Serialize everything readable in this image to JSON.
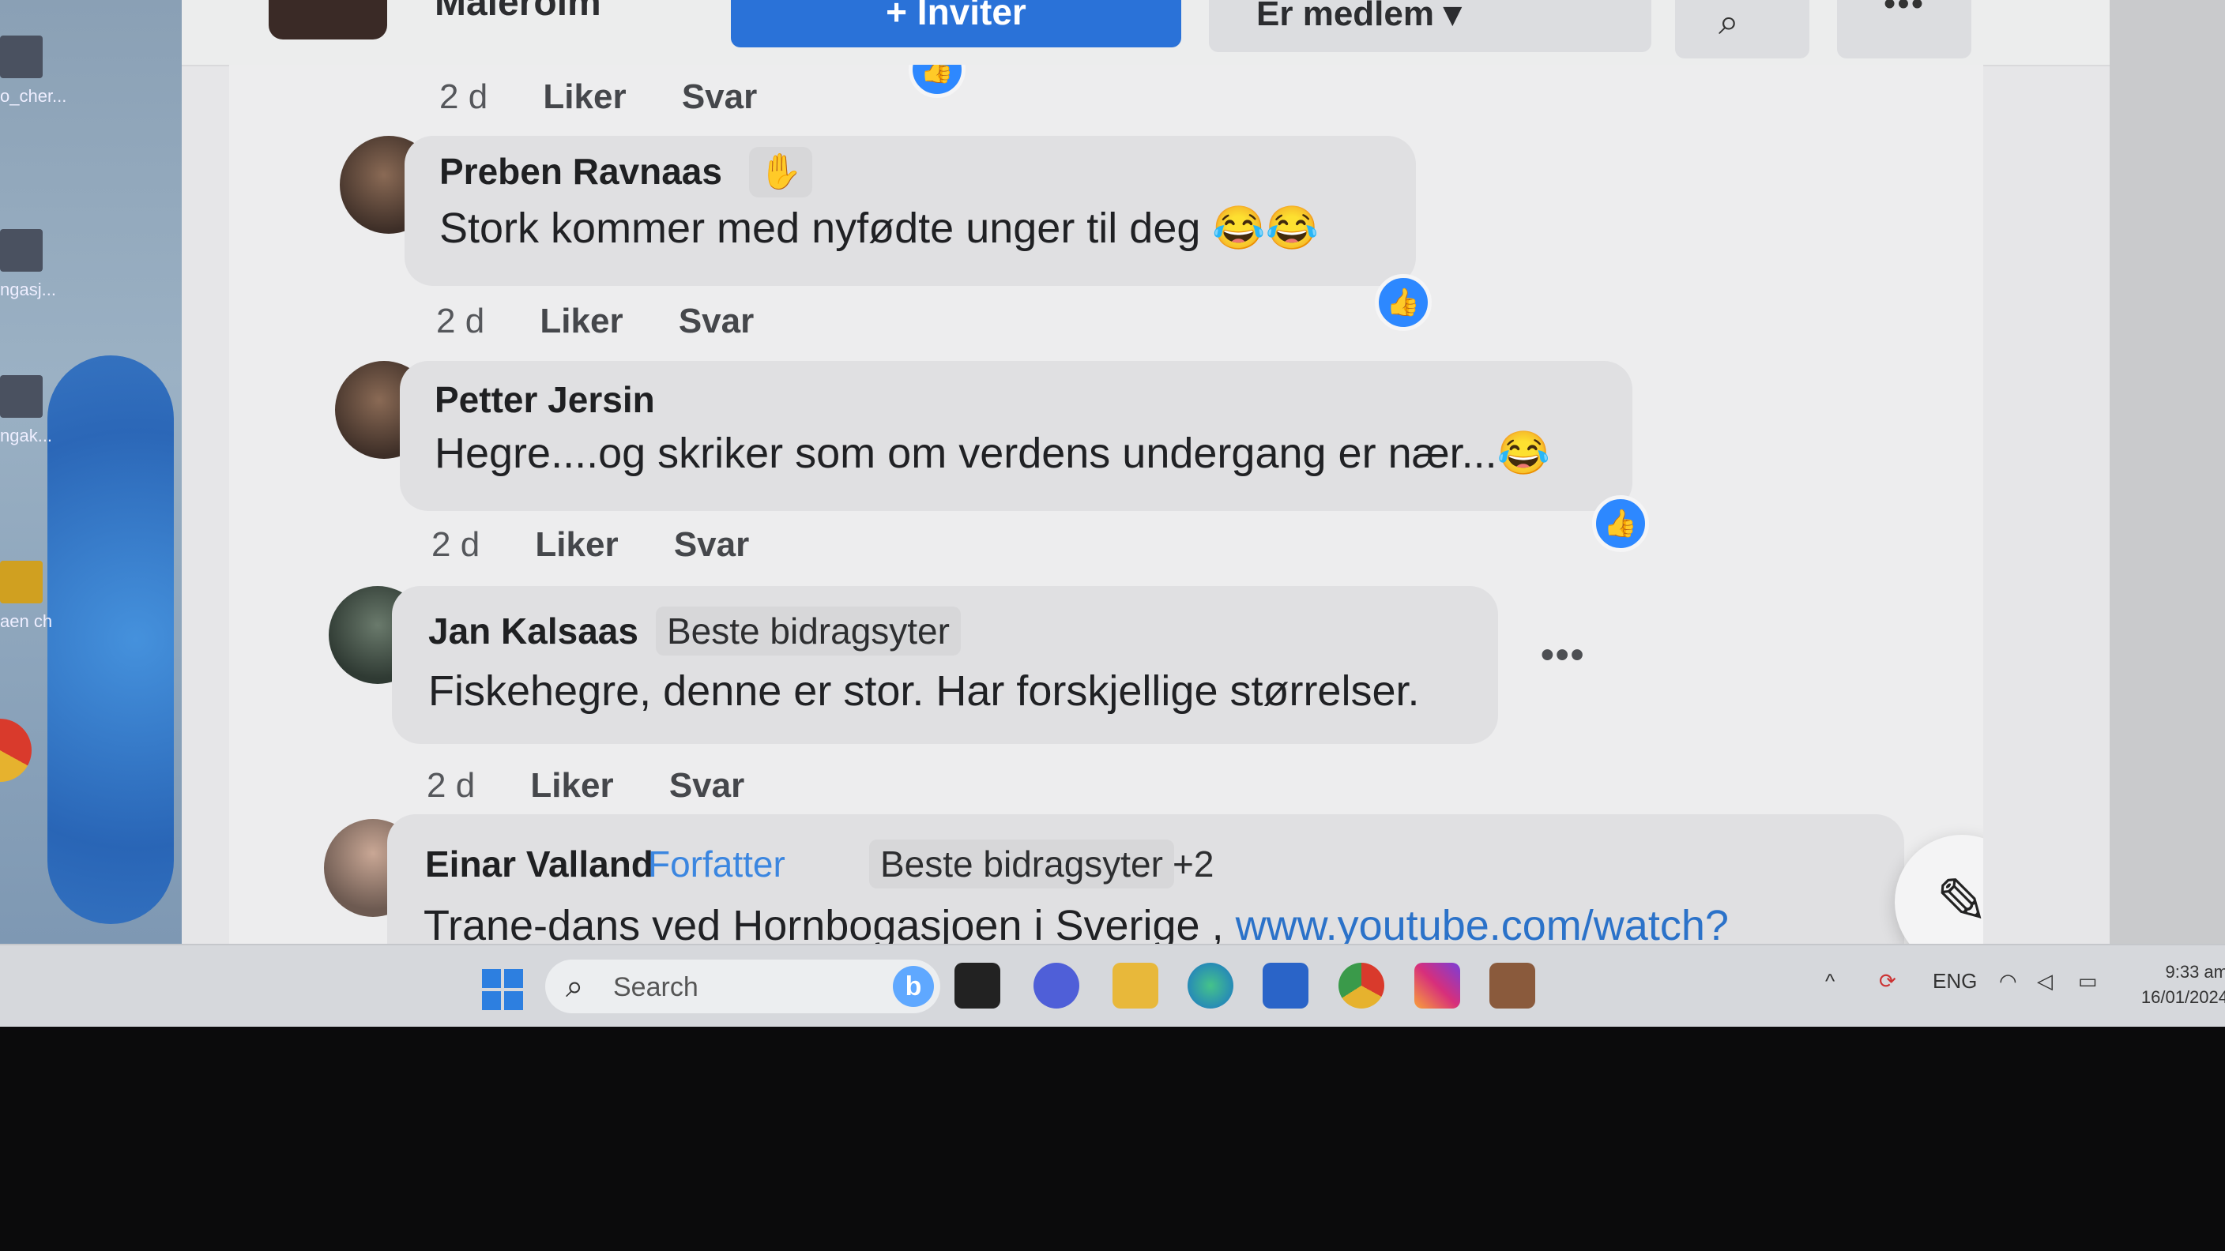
{
  "desktop": {
    "icon_labels": [
      "o_cher...",
      "ngasj...",
      "ngak...",
      "aen\nch"
    ]
  },
  "header": {
    "group_name": "Malerolm",
    "invite_label": "+ Inviter",
    "member_label": "Er medlem",
    "more_label": "•••"
  },
  "comments": [
    {
      "author": "",
      "time": "2 d",
      "like": "Liker",
      "reply": "Svar"
    },
    {
      "author": "Preben Ravnaas",
      "text": "Stork kommer med nyfødte unger til deg 😂😂",
      "time": "2 d",
      "like": "Liker",
      "reply": "Svar"
    },
    {
      "author": "Petter Jersin",
      "text": "Hegre....og skriker som om verdens undergang er nær...😂",
      "time": "2 d",
      "like": "Liker",
      "reply": "Svar"
    },
    {
      "author": "Jan Kalsaas",
      "badge": "Beste bidragsyter",
      "text": "Fiskehegre, denne er stor. Har forskjellige størrelser.",
      "time": "2 d",
      "like": "Liker",
      "reply": "Svar",
      "more": "•••"
    },
    {
      "author": "Einar Valland",
      "badge_author": "Forfatter",
      "badge": "Beste bidragsyter",
      "badge_more": "+2",
      "text": "Trane-dans ved Hornbogasjoen i Sverige , ",
      "link": "www.youtube.com/watch?"
    }
  ],
  "taskbar": {
    "search_placeholder": "Search",
    "language": "ENG",
    "time": "9:33 am",
    "date": "16/01/2024"
  },
  "colors": {
    "accent": "#2d88ff",
    "invite": "#2a72d8",
    "link": "#2b72c9",
    "author_badge": "#3b86e0",
    "online": "#31a24c"
  }
}
